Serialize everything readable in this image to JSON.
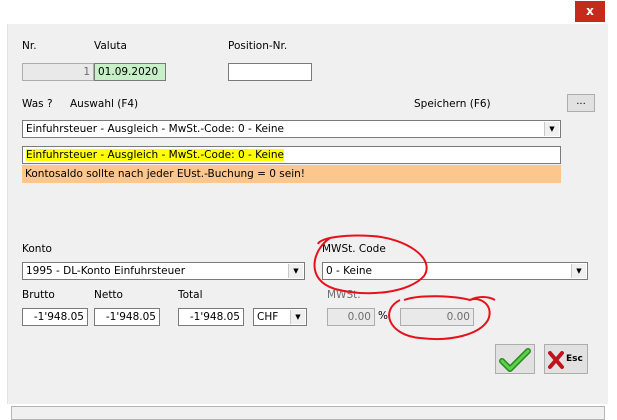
{
  "window": {
    "close_label": "x"
  },
  "header": {
    "nr_label": "Nr.",
    "nr_value": "1",
    "valuta_label": "Valuta",
    "valuta_value": "01.09.2020",
    "position_label": "Position-Nr.",
    "position_value": ""
  },
  "was": {
    "was_label": "Was ?",
    "auswahl_label": "Auswahl (F4)",
    "speichern_label": "Speichern (F6)",
    "browse_label": "...",
    "selection": "Einfuhrsteuer - Ausgleich - MwSt.-Code: 0 - Keine",
    "highlight_text": "Einfuhrsteuer - Ausgleich - MwSt.-Code: 0 - Keine",
    "warning_text": "Kontosaldo sollte nach jeder EUst.-Buchung = 0 sein!"
  },
  "konto": {
    "label": "Konto",
    "value": "1995 - DL-Konto Einfuhrsteuer"
  },
  "mwst_code": {
    "label": "MWSt. Code",
    "value": "0 - Keine"
  },
  "amounts": {
    "brutto_label": "Brutto",
    "brutto_value": "-1'948.05",
    "netto_label": "Netto",
    "netto_value": "-1'948.05",
    "total_label": "Total",
    "total_value": "-1'948.05",
    "currency": "CHF",
    "mwst_label": "MWSt.",
    "mwst_rate": "0.00",
    "percent_sign": "%",
    "mwst_amount": "0.00"
  },
  "actions": {
    "ok_icon": "green-checkmark-icon",
    "esc_label": "Esc"
  },
  "colors": {
    "highlight": "#ffff00",
    "warning": "#fcc68c",
    "valuta_bg": "#c8f0c8",
    "annotation": "#e8101a"
  }
}
